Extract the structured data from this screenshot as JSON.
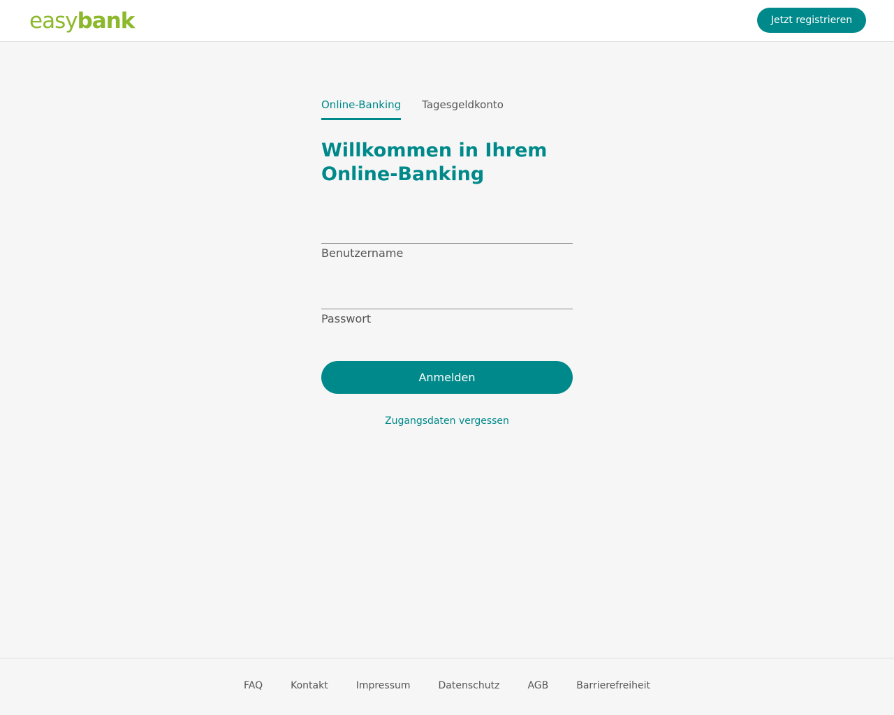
{
  "header": {
    "logo_light": "easy",
    "logo_bold": "bank",
    "register_label": "Jetzt registrieren"
  },
  "tabs": [
    {
      "label": "Online-Banking",
      "active": true
    },
    {
      "label": "Tagesgeldkonto",
      "active": false
    }
  ],
  "login": {
    "welcome_line1": "Willkommen in Ihrem",
    "welcome_line2": "Online-Banking",
    "username_label": "Benutzername",
    "username_value": "",
    "password_label": "Passwort",
    "password_value": "",
    "submit_label": "Anmelden",
    "forgot_label": "Zugangsdaten vergessen"
  },
  "footer": {
    "links": [
      "FAQ",
      "Kontakt",
      "Impressum",
      "Datenschutz",
      "AGB",
      "Barrierefreiheit"
    ]
  },
  "colors": {
    "accent": "#00898a",
    "logo": "#8cb82b",
    "background": "#f6f6f6"
  }
}
